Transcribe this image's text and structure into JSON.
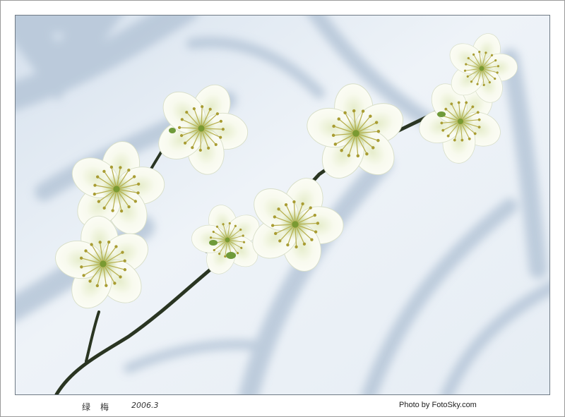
{
  "caption": {
    "title": "绿梅",
    "date": "2006.3",
    "credit": "Photo by FotoSky.com"
  },
  "colors": {
    "background_light": "#e9f0f6",
    "shadow_blue": "#b9c8d8",
    "petal": "#f6f8ec",
    "petal_shade": "#dfe8c6",
    "stamen": "#b9b24a",
    "calyx": "#6f9a3a",
    "branch": "#2d3a24"
  }
}
